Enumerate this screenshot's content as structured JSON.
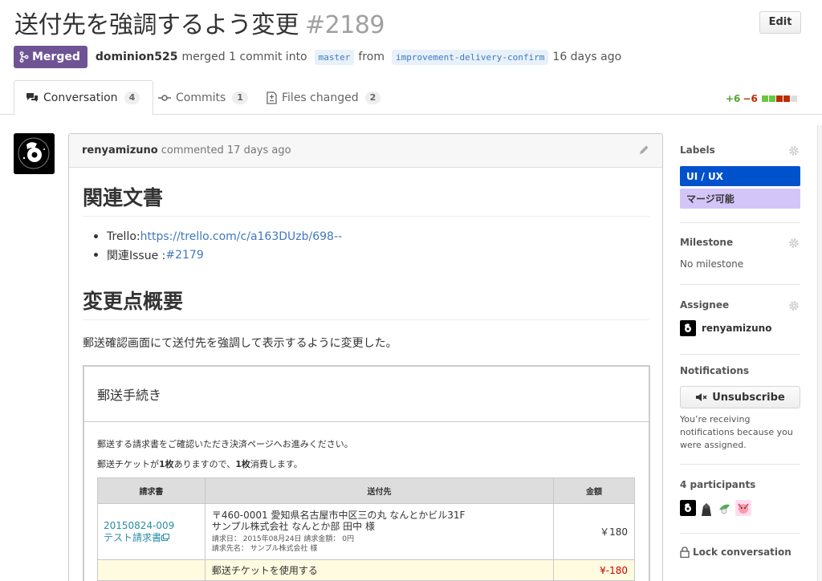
{
  "header": {
    "title": "送付先を強調するよう変更",
    "number": "#2189",
    "edit_label": "Edit"
  },
  "meta": {
    "state": "Merged",
    "author": "dominion525",
    "merged_text": "merged 1 commit into",
    "base_branch": "master",
    "from_text": "from",
    "head_branch": "improvement-delivery-confirm",
    "time": "16 days ago"
  },
  "tabs": [
    {
      "label": "Conversation",
      "count": "4",
      "icon": "comment-discussion-icon"
    },
    {
      "label": "Commits",
      "count": "1",
      "icon": "git-commit-icon"
    },
    {
      "label": "Files changed",
      "count": "2",
      "icon": "file-diff-icon"
    }
  ],
  "diffstat": {
    "additions": "+6",
    "deletions": "−6",
    "colors": {
      "add": "#6cc644",
      "del": "#bd2c00",
      "neutral": "#ddd"
    }
  },
  "comment": {
    "author": "renyamizuno",
    "action": "commented 17 days ago",
    "h1_related": "関連文書",
    "list": [
      {
        "prefix": "Trello: ",
        "link": "https://trello.com/c/a163DUzb/698--"
      },
      {
        "prefix": "関連Issue : ",
        "link": "#2179"
      }
    ],
    "h1_summary": "変更点概要",
    "paragraph": "郵送確認画面にて送付先を強調して表示するように変更した。",
    "embed": {
      "title": "郵送手続き",
      "line1": "郵送する請求書をご確認いただき決済ページへお進みください。",
      "line2_a": "郵送チケットが",
      "line2_b": "1枚",
      "line2_c": "ありますので、",
      "line2_d": "1枚",
      "line2_e": "消費します。",
      "table": {
        "headers": [
          "請求書",
          "送付先",
          "金額"
        ],
        "row": {
          "invoice_no": "20150824-009",
          "invoice_name": "テスト請求書",
          "addr_line1": "〒460-0001 愛知県名古屋市中区三の丸 なんとかビル31F",
          "addr_line2": "サンプル株式会社 なんとか部 田中 様",
          "detail1": "請求日： 2015年08月24日  請求金額： 0円",
          "detail2": "請求先名： サンプル株式会社 様",
          "amount": "￥180"
        },
        "ticket_row": {
          "label": "郵送チケットを使用する",
          "amount": "¥-180"
        }
      }
    }
  },
  "sidebar": {
    "labels_title": "Labels",
    "labels": [
      {
        "name": "UI / UX",
        "bg": "#0052cc",
        "fg": "#ffffff"
      },
      {
        "name": "マージ可能",
        "bg": "#d4c5f9",
        "fg": "#333333"
      }
    ],
    "milestone_title": "Milestone",
    "milestone_value": "No milestone",
    "assignee_title": "Assignee",
    "assignee_name": "renyamizuno",
    "notifications_title": "Notifications",
    "unsubscribe_label": "Unsubscribe",
    "notif_text_1": "You’re receiving",
    "notif_text_2": "notifications because you",
    "notif_text_3": "were assigned.",
    "participants_title": "4 participants",
    "lock_label": "Lock conversation"
  }
}
